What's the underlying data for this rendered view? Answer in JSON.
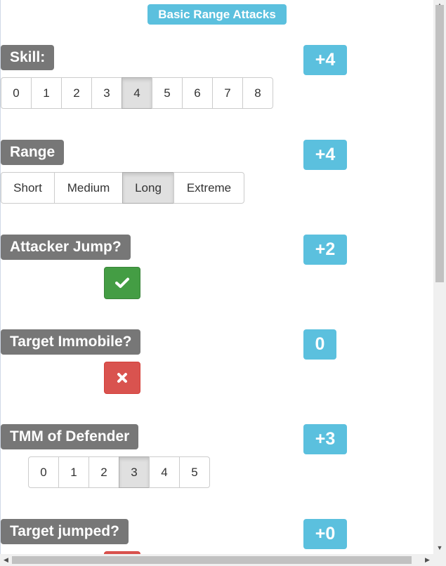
{
  "title": "Basic Range Attacks",
  "skill": {
    "label": "Skill:",
    "modifier": "+4",
    "options": [
      "0",
      "1",
      "2",
      "3",
      "4",
      "5",
      "6",
      "7",
      "8"
    ],
    "selected": "4"
  },
  "range": {
    "label": "Range",
    "modifier": "+4",
    "options": [
      "Short",
      "Medium",
      "Long",
      "Extreme"
    ],
    "selected": "Long"
  },
  "attacker_jump": {
    "label": "Attacker Jump?",
    "modifier": "+2",
    "toggle": "on",
    "icon": "check-icon",
    "color": "#449d44"
  },
  "target_immobile": {
    "label": "Target Immobile?",
    "modifier": "0",
    "toggle": "off",
    "icon": "close-icon",
    "color": "#d9534f"
  },
  "tmm": {
    "label": "TMM of Defender",
    "modifier": "+3",
    "options": [
      "0",
      "1",
      "2",
      "3",
      "4",
      "5"
    ],
    "selected": "3"
  },
  "target_jumped": {
    "label": "Target jumped?",
    "modifier": "+0",
    "color": "#d9534f"
  },
  "colors": {
    "info": "#5bc0de",
    "label": "#777777",
    "success": "#449d44",
    "danger": "#d9534f"
  }
}
